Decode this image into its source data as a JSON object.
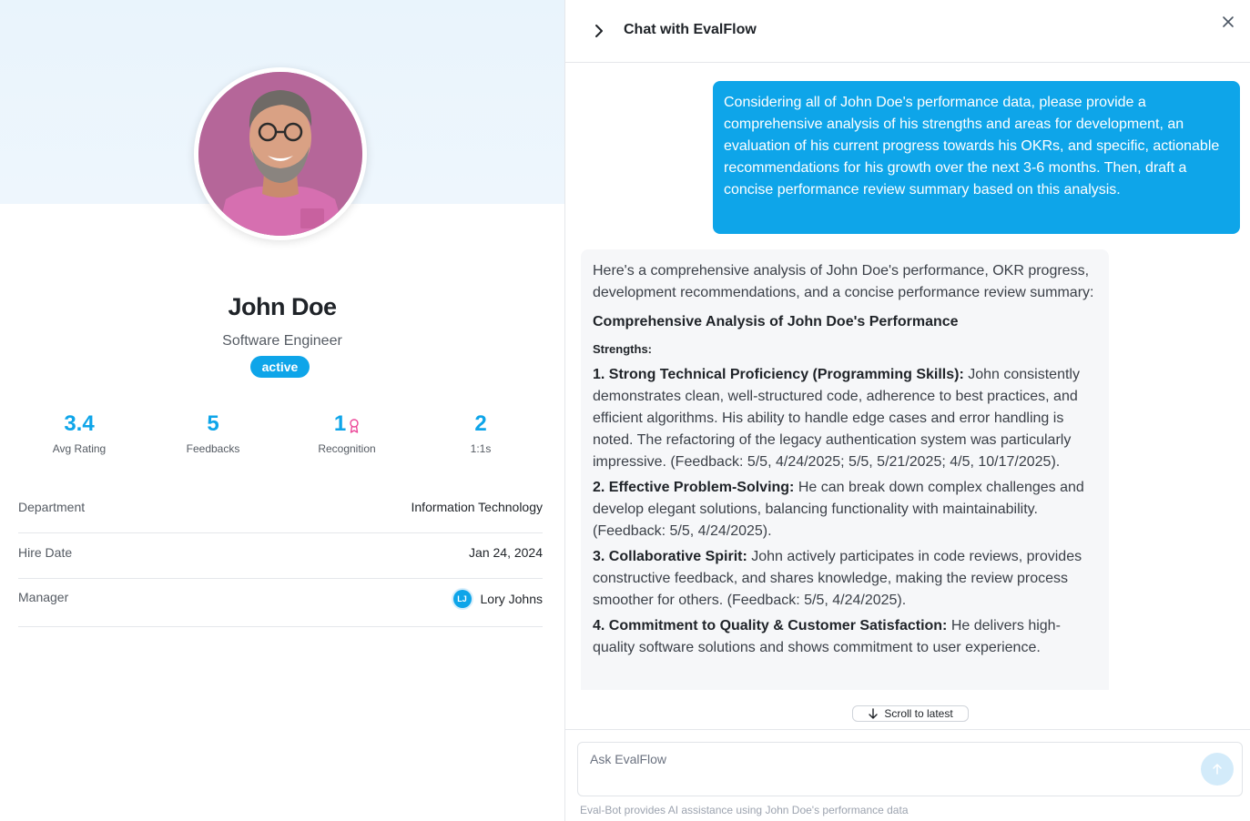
{
  "profile": {
    "name": "John Doe",
    "role": "Software Engineer",
    "status": "active",
    "stats": [
      {
        "value": "3.4",
        "label": "Avg Rating"
      },
      {
        "value": "5",
        "label": "Feedbacks"
      },
      {
        "value": "1",
        "label": "Recognition",
        "icon": "ribbon-icon"
      },
      {
        "value": "2",
        "label": "1:1s"
      }
    ],
    "details": {
      "department_label": "Department",
      "department_value": "Information Technology",
      "hire_label": "Hire Date",
      "hire_value": "Jan 24, 2024",
      "manager_label": "Manager",
      "manager_initials": "LJ",
      "manager_name": "Lory Johns"
    },
    "colors": {
      "accent": "#0ea5e9",
      "ribbon": "#ec4899"
    }
  },
  "chat": {
    "title": "Chat with EvalFlow",
    "user_message": "Considering all of John Doe's performance data, please provide a comprehensive analysis of his strengths and areas for development, an evaluation of his current progress towards his OKRs, and specific, actionable recommendations for his growth over the next 3-6 months. Then, draft a concise performance review summary based on this analysis.",
    "bot": {
      "intro": "Here's a comprehensive analysis of John Doe's performance, OKR progress, development recommendations, and a concise performance review summary:",
      "heading": "Comprehensive Analysis of John Doe's Performance",
      "subheading": "Strengths:",
      "items": [
        {
          "title": "1. Strong Technical Proficiency (Programming Skills):",
          "text": " John consistently demonstrates clean, well-structured code, adherence to best practices, and efficient algorithms. His ability to handle edge cases and error handling is noted. The refactoring of the legacy authentication system was particularly impressive. (Feedback: 5/5, 4/24/2025; 5/5, 5/21/2025; 4/5, 10/17/2025)."
        },
        {
          "title": "2. Effective Problem-Solving:",
          "text": " He can break down complex challenges and develop elegant solutions, balancing functionality with maintainability. (Feedback: 5/5, 4/24/2025)."
        },
        {
          "title": "3. Collaborative Spirit:",
          "text": " John actively participates in code reviews, provides constructive feedback, and shares knowledge, making the review process smoother for others. (Feedback: 5/5, 4/24/2025)."
        },
        {
          "title": "4. Commitment to Quality & Customer Satisfaction:",
          "text": " He delivers high-quality software solutions and shows commitment to user experience."
        }
      ]
    },
    "scroll_label": "Scroll to latest",
    "input_placeholder": "Ask EvalFlow",
    "disclaimer": "Eval-Bot provides AI assistance using John Doe's performance data"
  }
}
